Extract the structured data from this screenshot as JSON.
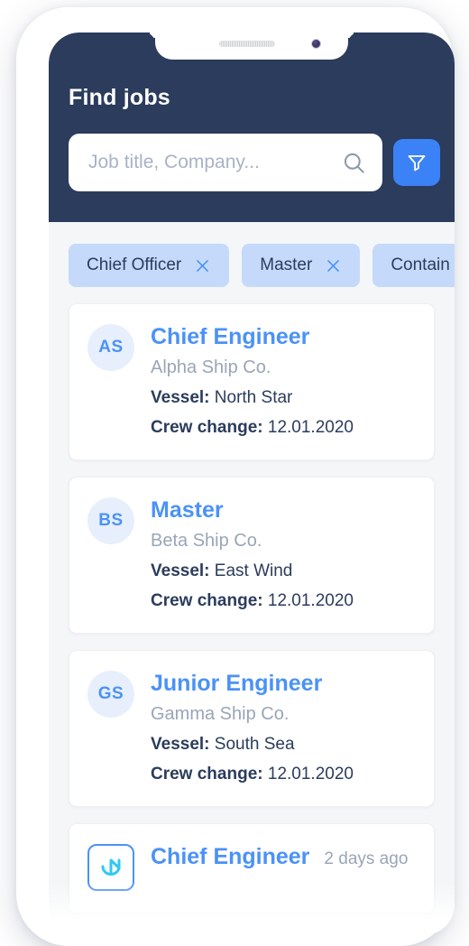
{
  "device": {
    "speaker_icon": "speaker-grille",
    "camera_icon": "front-camera-lens"
  },
  "colors": {
    "header_bg": "#2b3c5c",
    "accent_blue": "#3b82f6",
    "link_blue": "#4b92f7",
    "chip_bg": "#c5dafb",
    "screen_bg": "#f4f6f8",
    "muted_text": "#9aa5b8",
    "logo_cyan": "#2ec8f5"
  },
  "header": {
    "title": "Find jobs"
  },
  "search": {
    "value": "",
    "placeholder": "Job title, Company...",
    "search_icon": "search-icon",
    "filter_icon": "filter-funnel-icon"
  },
  "chips": [
    {
      "label": "Chief Officer",
      "close_icon": "close-icon"
    },
    {
      "label": "Master",
      "close_icon": "close-icon"
    },
    {
      "label": "Contain",
      "close_icon": "close-icon"
    }
  ],
  "jobs": [
    {
      "avatar_initials": "AS",
      "title": "Chief Engineer",
      "company": "Alpha Ship Co.",
      "vessel_label": "Vessel:",
      "vessel_value": "North Star",
      "crew_change_label": "Crew change:",
      "crew_change_value": "12.01.2020",
      "age": ""
    },
    {
      "avatar_initials": "BS",
      "title": "Master",
      "company": "Beta Ship Co.",
      "vessel_label": "Vessel:",
      "vessel_value": "East Wind",
      "crew_change_label": "Crew change:",
      "crew_change_value": "12.01.2020",
      "age": ""
    },
    {
      "avatar_initials": "GS",
      "title": "Junior Engineer",
      "company": "Gamma Ship Co.",
      "vessel_label": "Vessel:",
      "vessel_value": "South Sea",
      "crew_change_label": "Crew change:",
      "crew_change_value": "12.01.2020",
      "age": ""
    },
    {
      "avatar_initials": "",
      "logo_icon": "anchor-logo-icon",
      "title": "Chief Engineer",
      "company": "",
      "vessel_label": "",
      "vessel_value": "",
      "crew_change_label": "",
      "crew_change_value": "",
      "age": "2 days ago"
    }
  ]
}
